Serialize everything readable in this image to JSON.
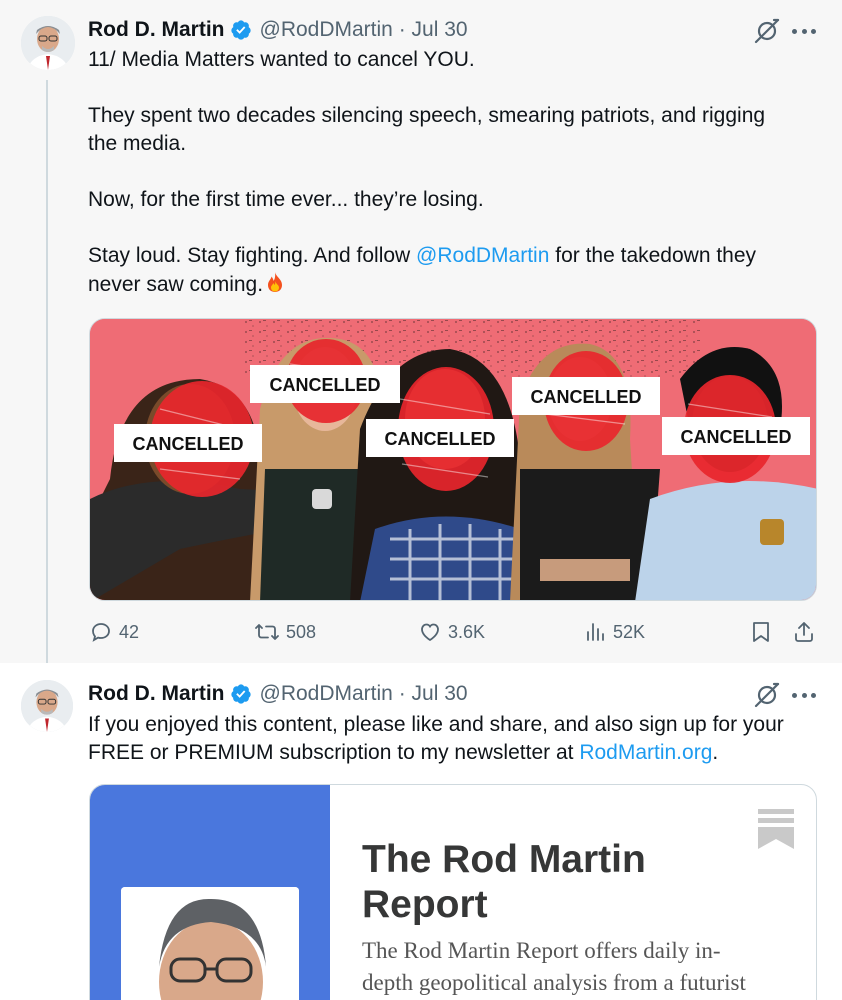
{
  "tweets": [
    {
      "author_name": "Rod D. Martin",
      "handle": "@RodDMartin",
      "separator": "·",
      "date": "Jul 30",
      "paragraphs": {
        "p1": "11/ Media Matters wanted to cancel YOU.",
        "p2a": "They spent two decades silencing speech, smearing patriots, and rigging",
        "p2b": "the media.",
        "p3": "Now, for the first time ever... they’re losing.",
        "p4a_pre": "Stay loud. Stay fighting. And follow ",
        "p4a_mention": "@RodDMartin",
        "p4a_post": " for the takedown they",
        "p4b": "never saw coming."
      },
      "media": {
        "labels": [
          "CANCELLED",
          "CANCELLED",
          "CANCELLED",
          "CANCELLED",
          "CANCELLED"
        ]
      },
      "actions": {
        "replies": "42",
        "reposts": "508",
        "likes": "3.6K",
        "views": "52K"
      },
      "icons": [
        "verified-badge-icon",
        "grok-icon",
        "more-icon",
        "reply-icon",
        "repost-icon",
        "like-icon",
        "views-icon",
        "bookmark-icon",
        "share-icon",
        "fire-emoji"
      ]
    },
    {
      "author_name": "Rod D. Martin",
      "handle": "@RodDMartin",
      "separator": "·",
      "date": "Jul 30",
      "text_a": "If you enjoyed this content, please like and share, and also sign up for your",
      "text_b_pre": "FREE or PREMIUM subscription to my newsletter at ",
      "text_b_link": "RodMartin.org",
      "text_b_post": ".",
      "card": {
        "title_line1": "The Rod Martin",
        "title_line2": "Report",
        "desc_line1": "The Rod Martin Report offers daily in-",
        "desc_line2": "depth geopolitical analysis from a futurist"
      }
    }
  ],
  "colors": {
    "verified_blue": "#1d9bf0",
    "link_blue": "#1d9bf0",
    "secondary_text": "#536471",
    "thread_line": "#cfd9de",
    "media_bg": "#ef6c75",
    "card_left_bg": "#4a77dd",
    "scribble_red": "#e8262d"
  }
}
